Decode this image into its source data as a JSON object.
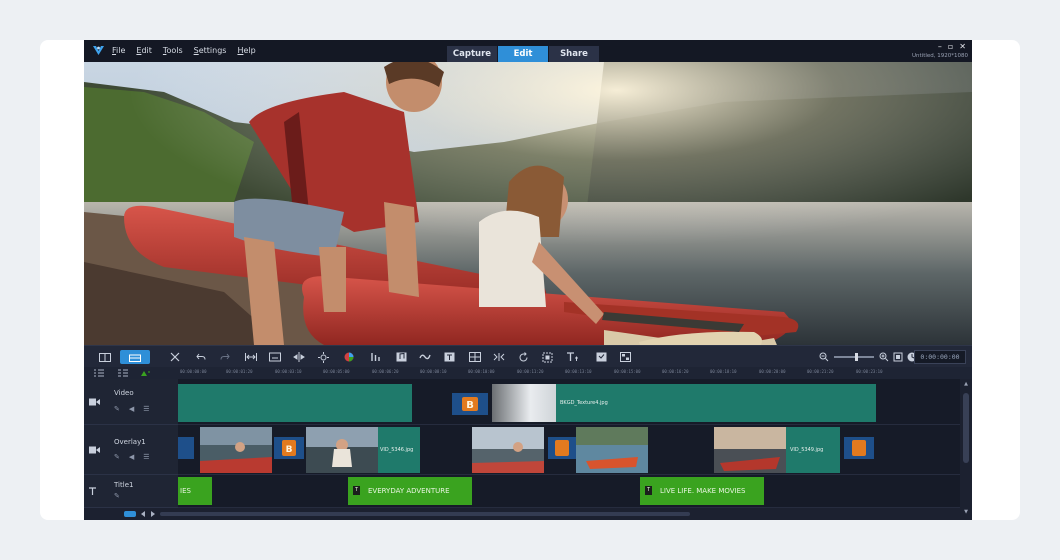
{
  "menubar": {
    "menus": [
      "File",
      "Edit",
      "Tools",
      "Settings",
      "Help"
    ],
    "modes": [
      {
        "label": "Capture",
        "active": false
      },
      {
        "label": "Edit",
        "active": true
      },
      {
        "label": "Share",
        "active": false
      }
    ],
    "window_controls": [
      "–",
      "▫",
      "✕"
    ],
    "project_info": "Untitled, 1920*1080"
  },
  "toolbar": {
    "timecode": "0:00:00:00"
  },
  "ruler": {
    "ticks": [
      "00:00:00:00",
      "00:00:01:20",
      "00:00:03:10",
      "00:00:05:00",
      "00:00:06:20",
      "00:00:08:10",
      "00:00:10:00",
      "00:00:11:20",
      "00:00:13:10",
      "00:00:15:00",
      "00:00:16:20",
      "00:00:18:10",
      "00:00:20:00",
      "00:00:21:20",
      "00:00:23:10"
    ]
  },
  "tracks": {
    "video": {
      "name": "Video",
      "clip_label": "BKGD_Texture4.jpg"
    },
    "overlay": {
      "name": "Overlay1",
      "clip1_label": "VID_5346.jpg",
      "clip2_label": "VID_5349.jpg"
    },
    "title": {
      "name": "Title1",
      "clip0_label": "IES",
      "clip1_label": "EVERYDAY ADVENTURE",
      "clip2_label": "LIVE LIFE. MAKE MOVIES"
    }
  },
  "colors": {
    "accent": "#2f8fd8",
    "video_clip": "#1f7a6b",
    "title_clip": "#3aa31f",
    "app_bg": "#1b2030"
  }
}
